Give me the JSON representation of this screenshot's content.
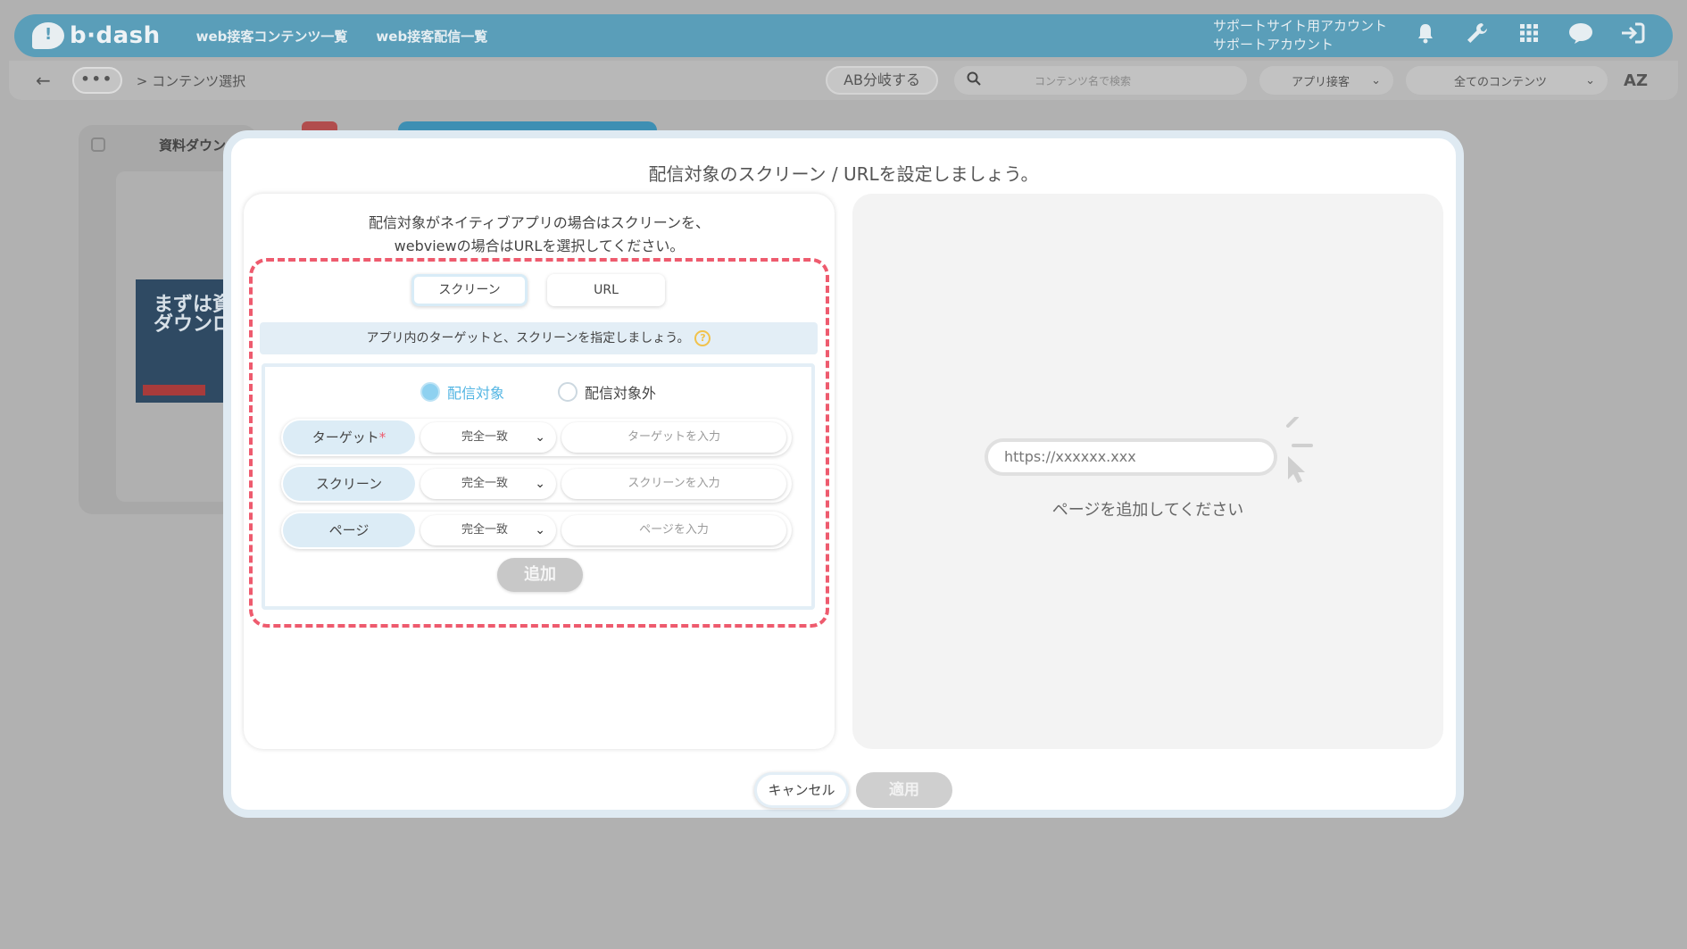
{
  "header": {
    "logo_text": "b·dash",
    "nav": [
      "web接客コンテンツ一覧",
      "web接客配信一覧"
    ],
    "account_line1": "サポートサイト用アカウント",
    "account_line2": "サポートアカウント",
    "icons": [
      "bell-icon",
      "wrench-icon",
      "grid-icon",
      "chat-icon",
      "logout-icon"
    ]
  },
  "toolbar": {
    "back_glyph": "←",
    "more_glyph": "•••",
    "breadcrumb": "> コンテンツ選択",
    "ab_button": "AB分岐する",
    "search_placeholder": "コンテンツ名で検索",
    "select1": "アプリ接客",
    "select2": "全てのコンテンツ",
    "sort_label": "AZ"
  },
  "background_card": {
    "title": "資料ダウンロ",
    "banner_text": "まずは資\nダウンロ"
  },
  "modal": {
    "title": "配信対象のスクリーン / URLを設定しましょう。",
    "description_line1": "配信対象がネイティブアプリの場合はスクリーンを、",
    "description_line2": "webviewの場合はURLを選択してください。",
    "tabs": {
      "screen": "スクリーン",
      "url": "URL"
    },
    "instruction": "アプリ内のターゲットと、スクリーンを指定しましょう。",
    "help_glyph": "?",
    "radio_on": "配信対象",
    "radio_off": "配信対象外",
    "fields": [
      {
        "label": "ターゲット",
        "required_mark": "*",
        "match": "完全一致",
        "placeholder": "ターゲットを入力"
      },
      {
        "label": "スクリーン",
        "required_mark": "",
        "match": "完全一致",
        "placeholder": "スクリーンを入力"
      },
      {
        "label": "ページ",
        "required_mark": "",
        "match": "完全一致",
        "placeholder": "ページを入力"
      }
    ],
    "add_button": "追加",
    "preview_url": "https://xxxxxx.xxx",
    "empty_message": "ページを追加してください",
    "cancel_button": "キャンセル",
    "apply_button": "適用"
  },
  "colors": {
    "header_bg": "#5a9eb9",
    "dashed_border": "#ee5b6e",
    "accent_blue": "#52b5e3",
    "label_bg": "#dcecf6"
  }
}
